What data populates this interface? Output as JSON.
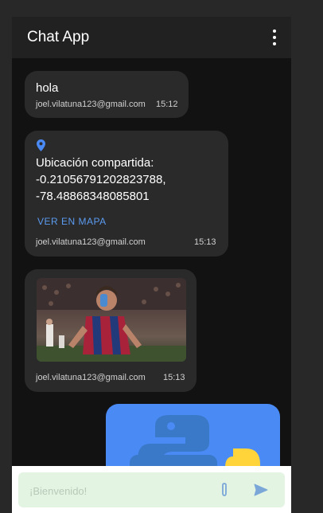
{
  "appbar": {
    "title": "Chat App",
    "menu_icon": "more-vert-icon"
  },
  "messages": [
    {
      "type": "text",
      "text": "hola",
      "sender": "joel.vilatuna123@gmail.com",
      "time": "15:12"
    },
    {
      "type": "location",
      "icon": "location-pin-icon",
      "text_line1": "Ubicación compartida:",
      "text_line2": "-0.21056791202823788,",
      "text_line3": "-78.48868348085801",
      "link_label": "VER EN MAPA",
      "sender": "joel.vilatuna123@gmail.com",
      "time": "15:13"
    },
    {
      "type": "image",
      "sender": "joel.vilatuna123@gmail.com",
      "time": "15:13"
    },
    {
      "type": "image",
      "icon": "python-logo-icon"
    }
  ],
  "composer": {
    "placeholder": "¡Bienvenido!",
    "value": "",
    "attach_icon": "paperclip-icon",
    "send_icon": "send-icon"
  },
  "colors": {
    "appbar": "#212121",
    "background": "#121212",
    "bubble": "#2a2a2a",
    "link": "#5b9bf0",
    "input_bg": "#e3f4e3",
    "python_blue": "#4a8af4"
  }
}
